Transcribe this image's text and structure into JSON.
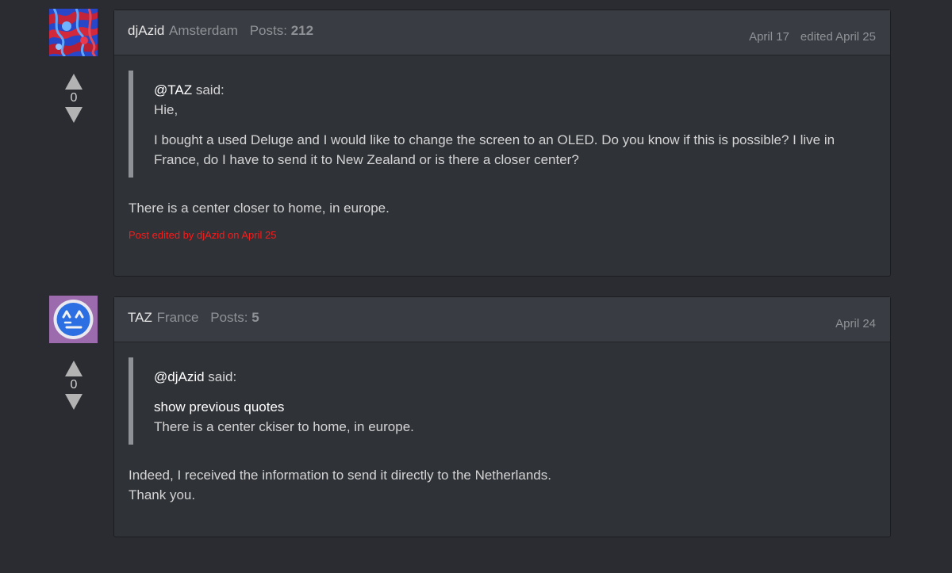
{
  "posts": [
    {
      "author": "djAzid",
      "location": "Amsterdam",
      "posts_label": "Posts:",
      "posts_count": "212",
      "date": "April 17",
      "edited": "edited April 25",
      "votes": "0",
      "quote": {
        "author": "@TAZ",
        "said": "said:",
        "line1": "Hie,",
        "line2": "I bought a used Deluge and I would like to change the screen to an OLED. Do you know if this is possible? I live in France, do I have to send it to New Zealand or is there a closer center?"
      },
      "reply": "There is a center closer to home, in europe.",
      "edit_note": "Post edited by djAzid on April 25"
    },
    {
      "author": "TAZ",
      "location": "France",
      "posts_label": "Posts:",
      "posts_count": "5",
      "date": "April 24",
      "votes": "0",
      "quote": {
        "author": "@djAzid",
        "said": "said:",
        "show_previous": "show previous quotes",
        "line1": "There is a center ckiser to home, in europe."
      },
      "reply_line1": "Indeed, I received the information to send it directly to the Netherlands.",
      "reply_line2": "Thank you."
    }
  ]
}
